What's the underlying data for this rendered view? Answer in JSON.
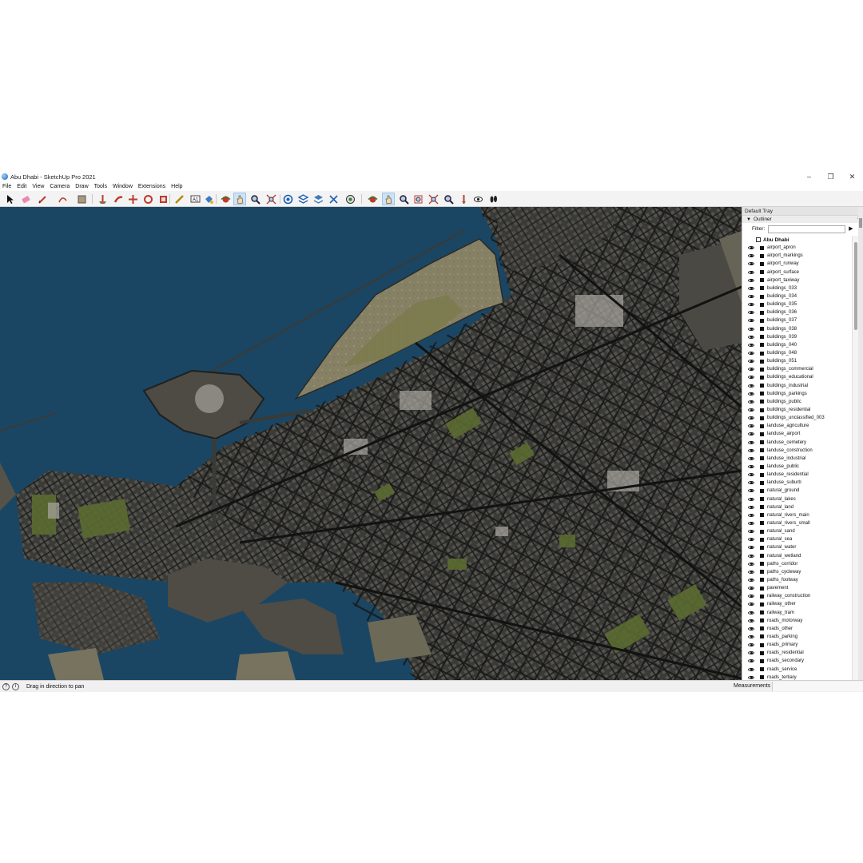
{
  "window": {
    "title": "Abu Dhabi - SketchUp Pro 2021",
    "controls": [
      "minimize-icon",
      "restore-icon",
      "close-icon"
    ]
  },
  "menu": [
    "File",
    "Edit",
    "View",
    "Camera",
    "Draw",
    "Tools",
    "Window",
    "Extensions",
    "Help"
  ],
  "toolbar": {
    "tools": [
      {
        "icon": "select-arrow-icon"
      },
      {
        "icon": "eraser-icon"
      },
      {
        "icon": "pencil-line-icon"
      },
      {
        "icon": "arc-icon"
      },
      {
        "icon": "rectangle-shape-icon"
      },
      {
        "icon": "push-pull-icon"
      },
      {
        "icon": "follow-me-icon"
      },
      {
        "icon": "move-icon"
      },
      {
        "icon": "rotate-icon"
      },
      {
        "icon": "scale-icon"
      },
      {
        "icon": "tape-measure-icon"
      },
      {
        "icon": "text-icon"
      },
      {
        "icon": "paint-bucket-icon"
      },
      {
        "icon": "orbit-icon"
      },
      {
        "icon": "pan-icon",
        "active": true
      },
      {
        "icon": "zoom-icon"
      },
      {
        "icon": "zoom-extents-icon"
      },
      {
        "icon": "warehouse-icon"
      },
      {
        "icon": "extension-warehouse-icon"
      },
      {
        "icon": "layout-icon"
      },
      {
        "icon": "extension-manager-icon"
      },
      {
        "icon": "style-icon"
      },
      {
        "icon": "orbit-icon"
      },
      {
        "icon": "pan-icon",
        "active": true
      },
      {
        "icon": "zoom-icon"
      },
      {
        "icon": "zoom-window-icon"
      },
      {
        "icon": "zoom-extents-icon"
      },
      {
        "icon": "previous-view-icon"
      },
      {
        "icon": "position-camera-icon"
      },
      {
        "icon": "look-around-icon"
      },
      {
        "icon": "walk-icon"
      }
    ]
  },
  "tray": {
    "title": "Default Tray",
    "panel": "Outliner",
    "filter_label": "Filter:",
    "filter_value": "",
    "root": "Abu Dhabi",
    "items": [
      "airport_apron",
      "airport_markings",
      "airport_runway",
      "airport_surface",
      "airport_taxiway",
      "buildings_033",
      "buildings_034",
      "buildings_035",
      "buildings_036",
      "buildings_037",
      "buildings_038",
      "buildings_039",
      "buildings_040",
      "buildings_048",
      "buildings_051",
      "buildings_commercial",
      "buildings_educational",
      "buildings_industrial",
      "buildings_parkings",
      "buildings_public",
      "buildings_residential",
      "buildings_unclassified_003",
      "landuse_agriculture",
      "landuse_airport",
      "landuse_cemetery",
      "landuse_construction",
      "landuse_industrial",
      "landuse_public",
      "landuse_residential",
      "landuse_suburb",
      "natural_ground",
      "natural_lakes",
      "natural_land",
      "natural_rivers_main",
      "natural_rivers_small",
      "natural_sand",
      "natural_sea",
      "natural_water",
      "natural_wetland",
      "paths_corridor",
      "paths_cycleway",
      "paths_footway",
      "pavement",
      "railway_construction",
      "railway_other",
      "railway_tram",
      "roads_motorway",
      "roads_other",
      "roads_parking",
      "roads_primary",
      "roads_residential",
      "roads_secondary",
      "roads_service",
      "roads_tertiary"
    ]
  },
  "status": {
    "message": "Drag in direction to pan",
    "measurements_label": "Measurements",
    "measurements_value": ""
  },
  "colors": {
    "sea": "#1a4664",
    "land": "#6f6b5c",
    "city_dark": "#2c2c2a",
    "green": "#5e6b34",
    "sand": "#8a8566"
  }
}
